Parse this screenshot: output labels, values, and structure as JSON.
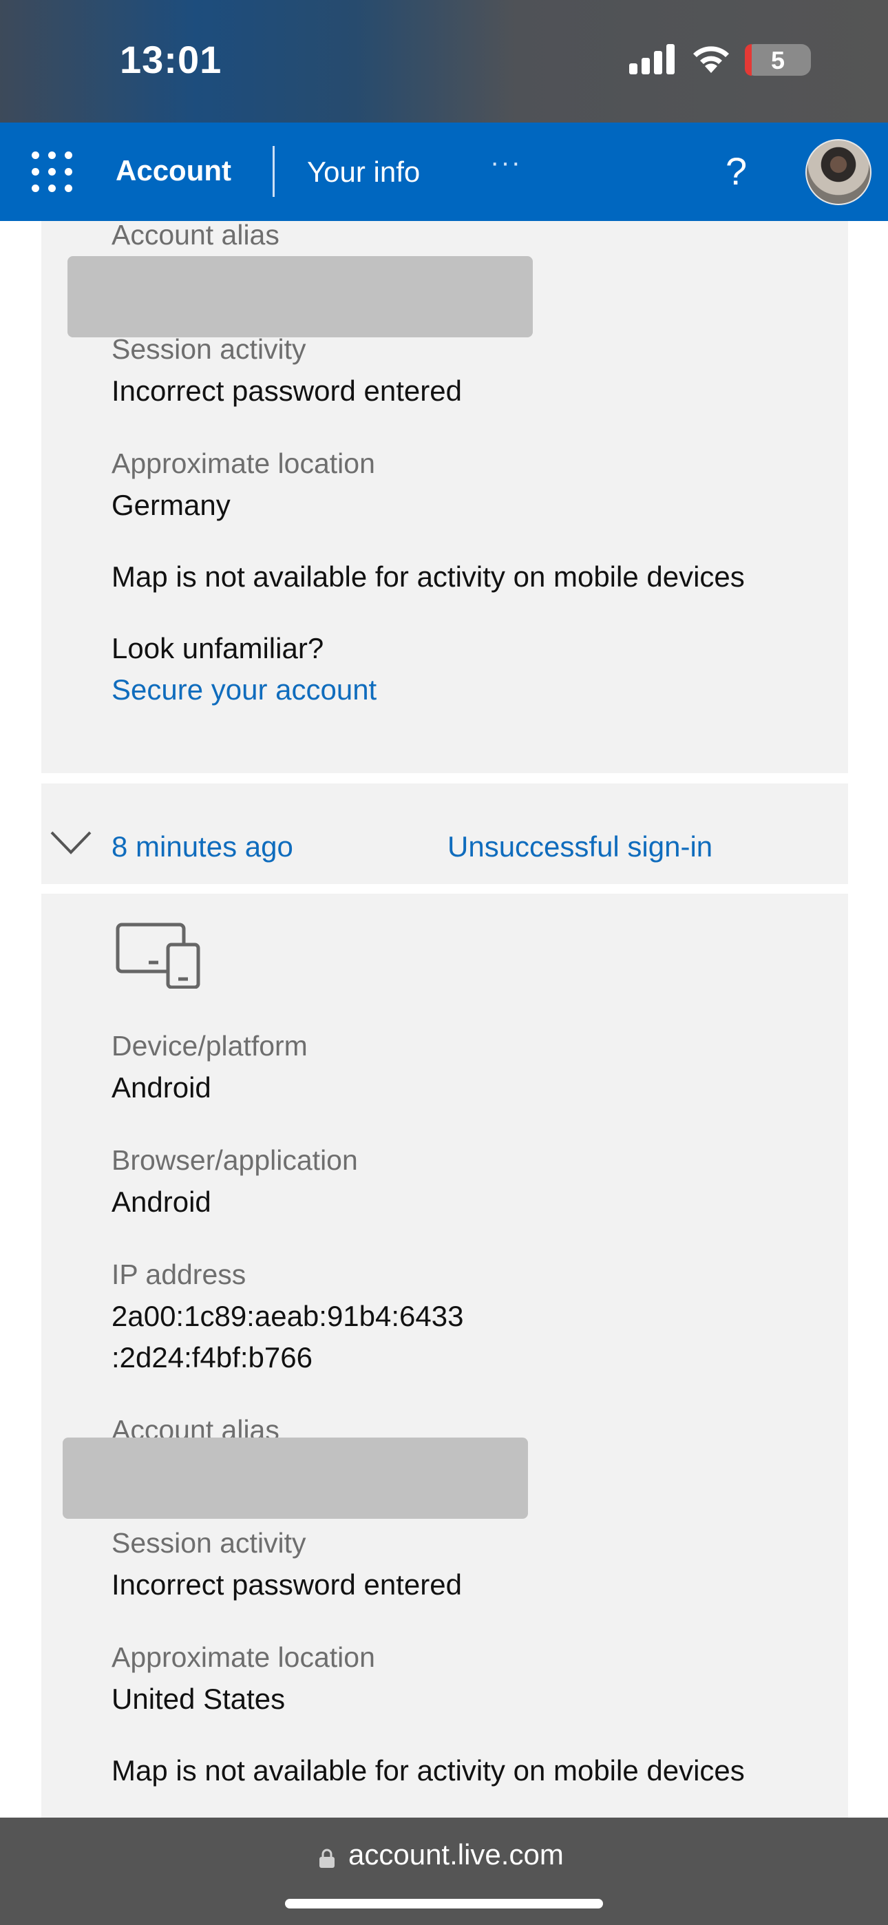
{
  "status_bar": {
    "time": "13:01",
    "battery": "5"
  },
  "header": {
    "app": "Account",
    "page": "Your info",
    "more": "···",
    "help": "?"
  },
  "events": [
    {
      "account_alias_label": "Account alias",
      "session_activity_label": "Session activity",
      "session_activity": "Incorrect password entered",
      "location_label": "Approximate location",
      "location": "Germany",
      "map_note": "Map is not available for activity on mobile devices",
      "unfamiliar": "Look unfamiliar?",
      "secure_link": "Secure your account"
    },
    {
      "time_ago": "8 minutes ago",
      "status": "Unsuccessful sign-in",
      "device_label": "Device/platform",
      "device": "Android",
      "browser_label": "Browser/application",
      "browser": "Android",
      "ip_label": "IP address",
      "ip_line1": "2a00:1c89:aeab:91b4:6433",
      "ip_line2": ":2d24:f4bf:b766",
      "account_alias_label": "Account alias",
      "session_activity_label": "Session activity",
      "session_activity": "Incorrect password entered",
      "location_label": "Approximate location",
      "location": "United States",
      "map_note": "Map is not available for activity on mobile devices"
    }
  ],
  "url_bar": {
    "url": "account.live.com"
  },
  "colors": {
    "brand": "#0067c0",
    "link": "#0f6cbd",
    "panel": "#f2f2f2"
  }
}
